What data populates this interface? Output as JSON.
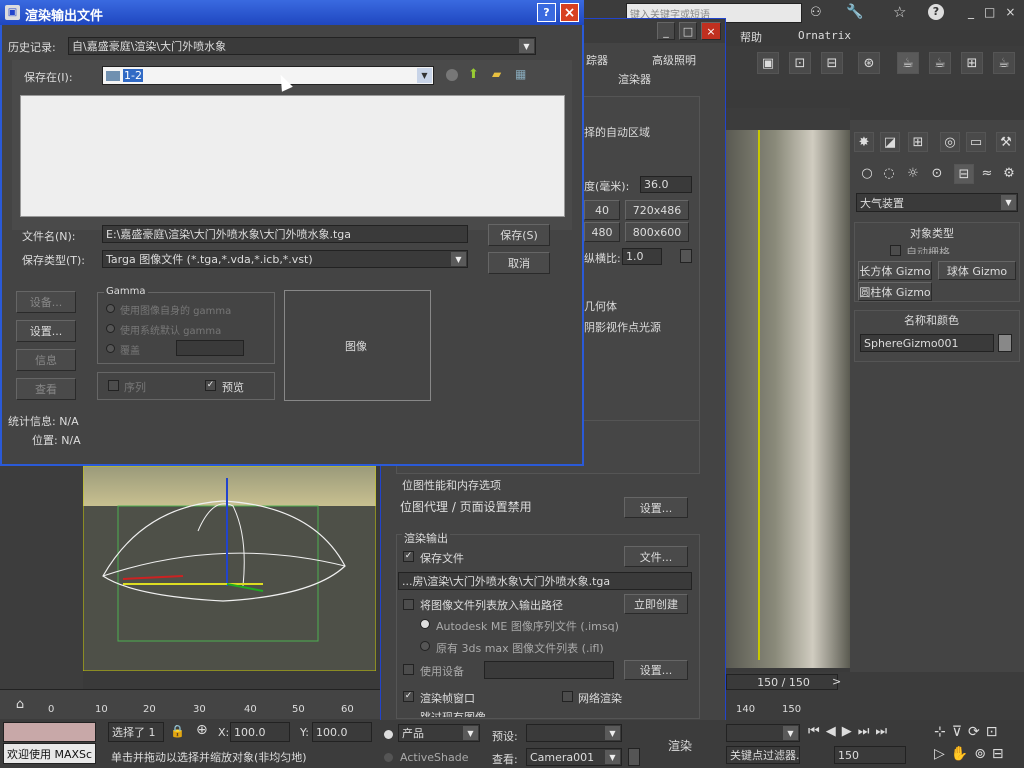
{
  "top": {
    "search_placeholder": "键入关键字或短语",
    "menu_help": "帮助",
    "menu_ornatrix": "Ornatrix"
  },
  "render_panel": {
    "tabs_row1": [
      "踪器",
      "高级照明"
    ],
    "tab_renderer": "渲染器",
    "region_text": "择的自动区域",
    "width_label": "度(毫米):",
    "width_value": "36.0",
    "size_btns": [
      "40",
      "720x486",
      "480",
      "800x600"
    ],
    "aspect_label": "纵横比:",
    "aspect_value": "1.0",
    "geometry": "几何体",
    "area_lights": "阴影视作点光源",
    "bitmap_header": "位图性能和内存选项",
    "bitmap_proxy": "位图代理 / 页面设置禁用",
    "setup_btn": "设置...",
    "render_output_header": "渲染输出",
    "save_file_label": "保存文件",
    "files_btn": "文件...",
    "output_path": "...房\\渲染\\大门外喷水象\\大门外喷水象.tga",
    "put_image_label": "将图像文件列表放入输出路径",
    "create_now_btn": "立即创建",
    "autodesk_seq": "Autodesk ME 图像序列文件 (.imsq)",
    "legacy_seq": "原有 3ds max 图像文件列表 (.ifl)",
    "use_device": "使用设备",
    "device_setup_btn": "设置...",
    "frame_window": "渲染帧窗口",
    "net_render": "网络渲染",
    "skip_existing": "跳过现有图像",
    "product_label": "产品",
    "preset_label": "预设:",
    "activeshade": "ActiveShade",
    "view_label": "查看:",
    "view_value": "Camera001",
    "render_btn": "渲染"
  },
  "command_panel": {
    "dropdown_value": "大气装置",
    "object_type_header": "对象类型",
    "auto_grid": "自动栅格",
    "box_gizmo": "长方体 Gizmo",
    "sphere_gizmo": "球体 Gizmo",
    "cylinder_gizmo": "圆柱体 Gizmo",
    "name_color_header": "名称和颜色",
    "name_value": "SphereGizmo001"
  },
  "timeline": {
    "counter": "150 / 150",
    "ticks": [
      "0",
      "10",
      "20",
      "30",
      "40",
      "50",
      "60"
    ],
    "right_ticks": [
      "140",
      "150"
    ]
  },
  "status": {
    "selected": "选择了 1",
    "x_label": "X:",
    "x_value": "100.0",
    "y_label": "Y:",
    "y_value": "100.0",
    "welcome": "欢迎使用 MAXSc",
    "hint": "单击并拖动以选择并缩放对象(非均匀地)",
    "filter": "关键点过滤器...",
    "frame_value": "150"
  },
  "dialog": {
    "title": "渲染输出文件",
    "history_label": "历史记录:",
    "history_value": "自\\嘉盛豪庭\\渲染\\大门外喷水象",
    "save_in_label": "保存在(I):",
    "save_in_value": "1-2",
    "filename_label": "文件名(N):",
    "filename_value": "E:\\嘉盛豪庭\\渲染\\大门外喷水象\\大门外喷水象.tga",
    "savetype_label": "保存类型(T):",
    "savetype_value": "Targa 图像文件 (*.tga,*.vda,*.icb,*.vst)",
    "save_btn": "保存(S)",
    "cancel_btn": "取消",
    "device_btn": "设备...",
    "setup_btn": "设置...",
    "info_btn": "信息",
    "view_btn": "查看",
    "gamma_title": "Gamma",
    "gamma_opt1": "使用图像自身的 gamma",
    "gamma_opt2": "使用系统默认 gamma",
    "gamma_opt3": "覆盖",
    "sequence": "序列",
    "preview": "预览",
    "image_label": "图像",
    "stats_label": "统计信息: N/A",
    "location_label": "位置: N/A",
    "help_icon": "?",
    "close_icon": "×"
  }
}
